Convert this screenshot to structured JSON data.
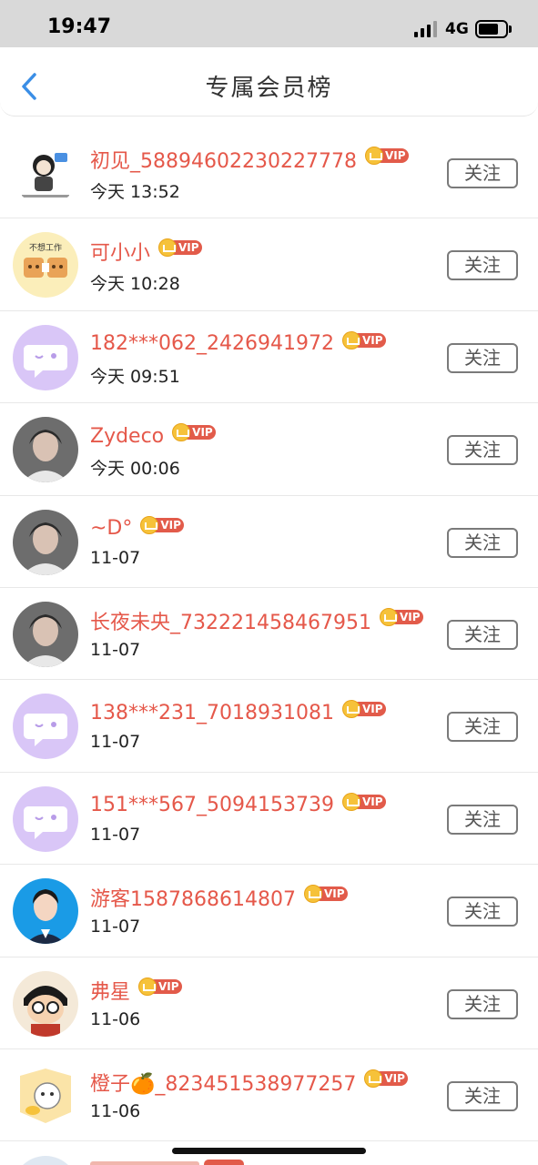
{
  "status_bar": {
    "time": "19:47",
    "network": "4G",
    "battery_level": 0.75
  },
  "nav": {
    "title": "专属会员榜",
    "back_icon": "chevron-left-icon"
  },
  "follow_label": "关注",
  "vip_label": "VIP",
  "colors": {
    "name": "#e5584a",
    "vip": "#e25b4a",
    "accent": "#3a8ee6"
  },
  "members": [
    {
      "name": "初见_58894602230227778",
      "time": "今天 13:52",
      "avatar": "sticker-avatar"
    },
    {
      "name": "可小小",
      "time": "今天 10:28",
      "avatar": "toast-avatar",
      "avatar_caption": "不想工作"
    },
    {
      "name": "182***062_2426941972",
      "time": "今天 09:51",
      "avatar": "default-avatar"
    },
    {
      "name": "Zydeco",
      "time": "今天 00:06",
      "avatar": "photo-avatar"
    },
    {
      "name": "~D°",
      "time": "11-07",
      "avatar": "photo-avatar"
    },
    {
      "name": "长夜未央_732221458467951",
      "time": "11-07",
      "avatar": "photo-avatar"
    },
    {
      "name": "138***231_7018931081",
      "time": "11-07",
      "avatar": "default-avatar"
    },
    {
      "name": "151***567_5094153739",
      "time": "11-07",
      "avatar": "default-avatar"
    },
    {
      "name": "游客1587868614807",
      "time": "11-07",
      "avatar": "portrait-avatar"
    },
    {
      "name": "弗星",
      "time": "11-06",
      "avatar": "cartoon-avatar"
    },
    {
      "name": "橙子🍊_823451538977257",
      "time": "11-06",
      "avatar": "cat-avatar"
    }
  ]
}
